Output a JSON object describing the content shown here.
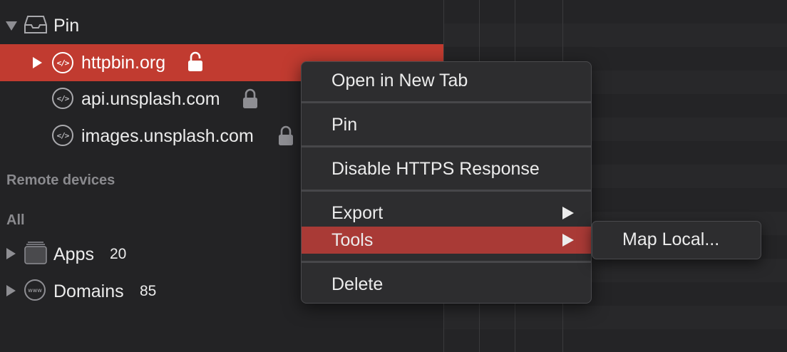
{
  "sidebar": {
    "pin": {
      "label": "Pin"
    },
    "pinned_items": [
      {
        "label": "httpbin.org",
        "selected": true
      },
      {
        "label": "api.unsplash.com",
        "selected": false
      },
      {
        "label": "images.unsplash.com",
        "selected": false
      }
    ],
    "remote_devices_header": "Remote devices",
    "all_header": "All",
    "apps": {
      "label": "Apps",
      "count": "20"
    },
    "domains": {
      "label": "Domains",
      "count": "85"
    },
    "domain_icon_text": "www",
    "code_icon_text": "</>"
  },
  "context_menu": {
    "items": [
      {
        "label": "Open in New Tab"
      },
      {
        "label": "Pin"
      },
      {
        "label": "Disable HTTPS Response"
      },
      {
        "label": "Export",
        "has_submenu": true
      },
      {
        "label": "Tools",
        "has_submenu": true,
        "active": true
      },
      {
        "label": "Delete"
      }
    ],
    "tools_submenu": [
      {
        "label": "Map Local..."
      }
    ]
  },
  "colors": {
    "selection": "#c13b30",
    "menu_highlight": "#a93a36",
    "background": "#232325",
    "menu_background": "#2d2d2f"
  }
}
